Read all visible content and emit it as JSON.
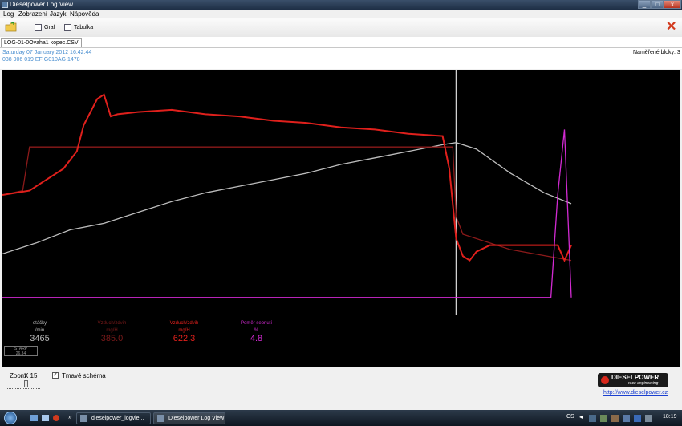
{
  "window": {
    "title": "Dieselpower Log View",
    "min": "_",
    "max": "□",
    "close": "x"
  },
  "menu": [
    "Log",
    "Zobrazení",
    "Jazyk",
    "Nápověda"
  ],
  "toolbar": {
    "graph_label": "Graf",
    "table_label": "Tabulka",
    "close_symbol": "✕"
  },
  "tab": {
    "label": "LOG-01-0Ovaha1 kopec.CSV"
  },
  "info": {
    "date": "Saturday 07 January 2012 16:42:44",
    "ecu": "038 906 019 EF  G010AG  1478",
    "blocks": "Naměřené bloky: 3"
  },
  "readouts": [
    {
      "label": "otáčky",
      "unit": "/min",
      "value": "3465",
      "color": "#b8b8b8"
    },
    {
      "label": "Vzduch/zdvih",
      "unit": "mg/H",
      "value": "385.0",
      "color": "#7a1a1a"
    },
    {
      "label": "Vzduch/zdvih",
      "unit": "mg/H",
      "value": "622.3",
      "color": "#e0201c"
    },
    {
      "label": "Poměr sepnutí",
      "unit": "%",
      "value": "4.8",
      "color": "#d22ad2"
    }
  ],
  "starp": {
    "label": "STARP",
    "value": "26.34"
  },
  "bottom": {
    "zoom_label": "Zoom",
    "zoom_value": "X 15",
    "dark_scheme_label": "Tmavé schéma",
    "dark_scheme_checked": true,
    "brand_name": "DIESELPOWER",
    "brand_tag": "race engineering",
    "website": "http://www.dieselpower.cz"
  },
  "taskbar": {
    "task1": "dieselpower_logvie...",
    "task2": "Dieselpower Log View",
    "lang": "CS",
    "time": "18:19"
  },
  "chart_data": {
    "type": "line",
    "cursor_x": 0.67,
    "series": [
      {
        "name": "otáčky",
        "color": "#bdbdbd",
        "x": [
          0,
          0.05,
          0.1,
          0.15,
          0.2,
          0.25,
          0.3,
          0.35,
          0.4,
          0.45,
          0.5,
          0.55,
          0.6,
          0.65,
          0.67,
          0.7,
          0.75,
          0.8,
          0.84
        ],
        "y": [
          0.23,
          0.28,
          0.34,
          0.37,
          0.42,
          0.47,
          0.51,
          0.54,
          0.57,
          0.6,
          0.64,
          0.67,
          0.7,
          0.73,
          0.74,
          0.71,
          0.6,
          0.51,
          0.46
        ]
      },
      {
        "name": "Vzduch/zdvih",
        "color": "#8c1a1a",
        "x": [
          0,
          0.03,
          0.04,
          0.2,
          0.4,
          0.6,
          0.665,
          0.67,
          0.68,
          0.75,
          0.84
        ],
        "y": [
          0.5,
          0.52,
          0.72,
          0.72,
          0.72,
          0.72,
          0.72,
          0.4,
          0.32,
          0.25,
          0.2
        ]
      },
      {
        "name": "Vzduch/zdvih",
        "color": "#e0201c",
        "x": [
          0,
          0.04,
          0.06,
          0.09,
          0.11,
          0.12,
          0.14,
          0.15,
          0.16,
          0.17,
          0.2,
          0.25,
          0.3,
          0.35,
          0.4,
          0.45,
          0.5,
          0.55,
          0.6,
          0.65,
          0.66,
          0.67,
          0.68,
          0.69,
          0.7,
          0.72,
          0.75,
          0.8,
          0.82,
          0.83,
          0.84
        ],
        "y": [
          0.5,
          0.52,
          0.56,
          0.62,
          0.7,
          0.82,
          0.94,
          0.96,
          0.86,
          0.87,
          0.88,
          0.89,
          0.87,
          0.86,
          0.84,
          0.83,
          0.81,
          0.8,
          0.78,
          0.77,
          0.62,
          0.3,
          0.22,
          0.2,
          0.24,
          0.27,
          0.27,
          0.27,
          0.27,
          0.2,
          0.27
        ]
      },
      {
        "name": "Poměr sepnutí",
        "color": "#d22ad2",
        "x": [
          0,
          0.7,
          0.81,
          0.82,
          0.83,
          0.84
        ],
        "y": [
          0.03,
          0.03,
          0.03,
          0.5,
          0.8,
          0.03
        ]
      }
    ]
  }
}
